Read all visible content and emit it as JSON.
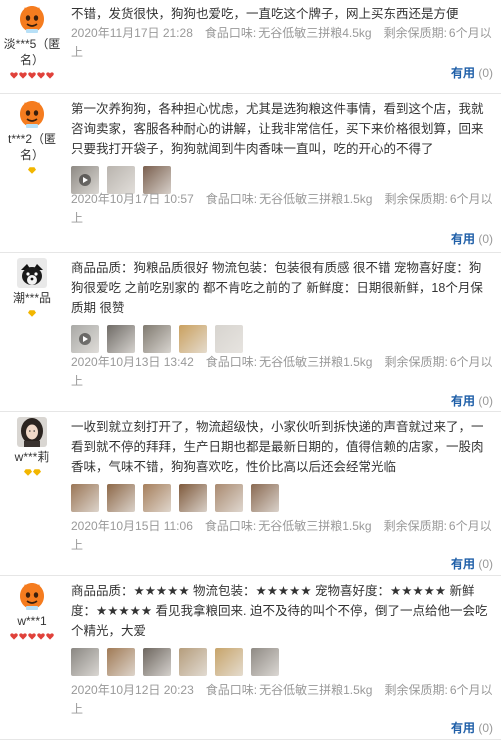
{
  "reviews": [
    {
      "user": "淡***5（匿名）",
      "avatar": "orange",
      "badge": "hearts",
      "text": "不错，发货很快，狗狗也爱吃，一直吃这个牌子，网上买东西还是方便",
      "date": "2020年11月17日 21:28",
      "taste_label": "食品口味:",
      "taste": "无谷低敏三拼粮4.5kg",
      "shelf_label": "剩余保质期:",
      "shelf": "6个月以上",
      "useful_label": "有用",
      "useful_count": "(0)",
      "thumbs": []
    },
    {
      "user": "t***2（匿名）",
      "avatar": "orange",
      "badge": "diamond",
      "text": "第一次养狗狗，各种担心忧虑，尤其是选狗粮这件事情，看到这个店，我就咨询卖家，客服各种耐心的讲解，让我非常信任，买下来价格很划算，回来只要我打开袋子，狗狗就闻到牛肉香味一直叫，吃的开心的不得了",
      "date": "2020年10月17日 10:57",
      "taste_label": "食品口味:",
      "taste": "无谷低敏三拼粮1.5kg",
      "shelf_label": "剩余保质期:",
      "shelf": "6个月以上",
      "useful_label": "有用",
      "useful_count": "(0)",
      "thumbs": [
        "#8e8a84",
        "#b9b4ae",
        "#7a5f4e"
      ]
    },
    {
      "user": "潮***品",
      "avatar": "dog",
      "badge": "diamond",
      "text": "商品品质：狗粮品质很好 物流包装：包装很有质感 很不错 宠物喜好度：狗狗很爱吃 之前吃别家的 都不肯吃之前的了 新鲜度：日期很新鲜，18个月保质期 很赞",
      "date": "2020年10月13日 13:42",
      "taste_label": "食品口味:",
      "taste": "无谷低敏三拼粮1.5kg",
      "shelf_label": "剩余保质期:",
      "shelf": "6个月以上",
      "useful_label": "有用",
      "useful_count": "(0)",
      "thumbs": [
        "#a9a9a6",
        "#6f6b66",
        "#807a70",
        "#c9a05f",
        "#d7d4cf"
      ]
    },
    {
      "user": "w***莉",
      "avatar": "girl",
      "badge": "diamond2",
      "text": "一收到就立刻打开了，物流超级快，小家伙听到拆快递的声音就过来了，一看到就不停的拜拜，生产日期也都是最新日期的，值得信赖的店家，一股肉香味，气味不错，狗狗喜欢吃，性价比高以后还会经常光临",
      "date": "2020年10月15日 11:06",
      "taste_label": "食品口味:",
      "taste": "无谷低敏三拼粮1.5kg",
      "shelf_label": "剩余保质期:",
      "shelf": "6个月以上",
      "useful_label": "有用",
      "useful_count": "(0)",
      "thumbs": [
        "#9a7656",
        "#8d6848",
        "#a67f5c",
        "#7f5a3c",
        "#a98a70",
        "#8a6a52"
      ]
    },
    {
      "user": "w***1",
      "avatar": "orange",
      "badge": "hearts",
      "text": "商品品质：★★★★★ 物流包装：★★★★★ 宠物喜好度：★★★★★ 新鲜度：★★★★★ 看见我拿粮回来. 迫不及待的叫个不停，倒了一点给他一会吃个精光，大爱",
      "date": "2020年10月12日 20:23",
      "taste_label": "食品口味:",
      "taste": "无谷低敏三拼粮1.5kg",
      "shelf_label": "剩余保质期:",
      "shelf": "6个月以上",
      "useful_label": "有用",
      "useful_count": "(0)",
      "thumbs": [
        "#8a8782",
        "#a07a55",
        "#6d665f",
        "#b59d7c",
        "#c7a46a",
        "#8f8a84"
      ]
    }
  ],
  "colors": {
    "link": "#1f5fa8",
    "meta": "#999999",
    "divider": "#e6e6e6",
    "heart": "#e0413a",
    "diamond": "#f2b600",
    "avatar_orange": "#f57c1f"
  }
}
